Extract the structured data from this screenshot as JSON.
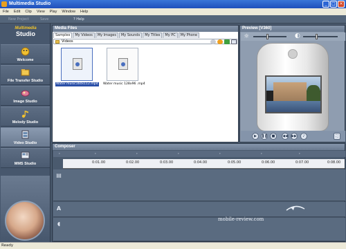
{
  "window": {
    "title": "Multimedia Studio"
  },
  "menu": [
    "File",
    "Edit",
    "Clip",
    "View",
    "Play",
    "Window",
    "Help"
  ],
  "toolbar": {
    "new_project": "New Project",
    "save": "Save",
    "help": "Help"
  },
  "sidebar": {
    "logo_line1": "Multimedia",
    "logo_line2": "Studio",
    "items": [
      {
        "label": "Welcome",
        "icon": "welcome-icon"
      },
      {
        "label": "File Transfer Studio",
        "icon": "folder-icon"
      },
      {
        "label": "Image Studio",
        "icon": "image-icon"
      },
      {
        "label": "Melody Studio",
        "icon": "music-note-icon"
      },
      {
        "label": "Video Studio",
        "icon": "film-icon"
      },
      {
        "label": "MMS Studio",
        "icon": "mms-icon"
      }
    ],
    "active_index": 4
  },
  "media_files": {
    "title": "Media Files",
    "tabs": [
      "Samples",
      "My Videos",
      "My Images",
      "My Sounds",
      "My Titles",
      "My PC",
      "My Phone"
    ],
    "active_tab": 0,
    "path": "Videos",
    "files": [
      {
        "name": "Water music160x112.mp4",
        "selected": true
      },
      {
        "name": "Water music 128x96 .mp4",
        "selected": false
      }
    ]
  },
  "preview": {
    "title": "Preview [V360]"
  },
  "composer": {
    "title": "Composer",
    "timeline_ticks": [
      "0:01.00",
      "0:02.00",
      "0:03.00",
      "0:04.00",
      "0:05.00",
      "0:06.00",
      "0:07.00",
      "0:08.00"
    ]
  },
  "watermark": "mobile-review.com",
  "status": "Ready",
  "colors": {
    "title_bar": "#1f4fbb",
    "panel_bg": "#4a5a6e",
    "selection": "#2a4fa8"
  }
}
